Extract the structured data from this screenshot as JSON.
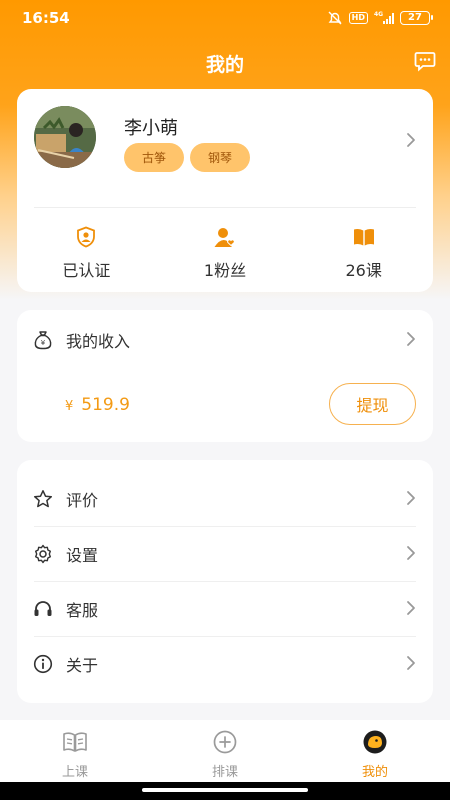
{
  "status_bar": {
    "time": "16:54",
    "network": "4G",
    "battery": "27",
    "hd": "HD",
    "icons": [
      "mute-alarm-icon",
      "hd-icon",
      "signal-icon",
      "battery-icon"
    ]
  },
  "header": {
    "title": "我的",
    "message_icon": "chat-bubble-icon"
  },
  "profile": {
    "name": "李小萌",
    "tags": [
      "古筝",
      "钢琴"
    ],
    "stats": [
      {
        "label": "已认证",
        "icon": "verified-shield-icon"
      },
      {
        "label": "1粉丝",
        "icon": "followers-icon"
      },
      {
        "label": "26课",
        "icon": "book-icon"
      }
    ]
  },
  "income": {
    "title": "我的收入",
    "currency": "¥",
    "amount": "519.9",
    "withdraw_label": "提现",
    "icon": "money-bag-icon"
  },
  "menu": [
    {
      "label": "评价",
      "icon": "star-icon"
    },
    {
      "label": "设置",
      "icon": "gear-icon"
    },
    {
      "label": "客服",
      "icon": "headset-icon"
    },
    {
      "label": "关于",
      "icon": "info-icon"
    }
  ],
  "tabs": [
    {
      "label": "上课",
      "icon": "open-book-icon",
      "active": false
    },
    {
      "label": "排课",
      "icon": "plus-circle-icon",
      "active": false
    },
    {
      "label": "我的",
      "icon": "profile-face-icon",
      "active": true
    }
  ],
  "colors": {
    "accent": "#ff9900",
    "accent_text": "#ef8f0a",
    "tag_bg": "#ffc46b",
    "background": "#f6f6f8"
  }
}
